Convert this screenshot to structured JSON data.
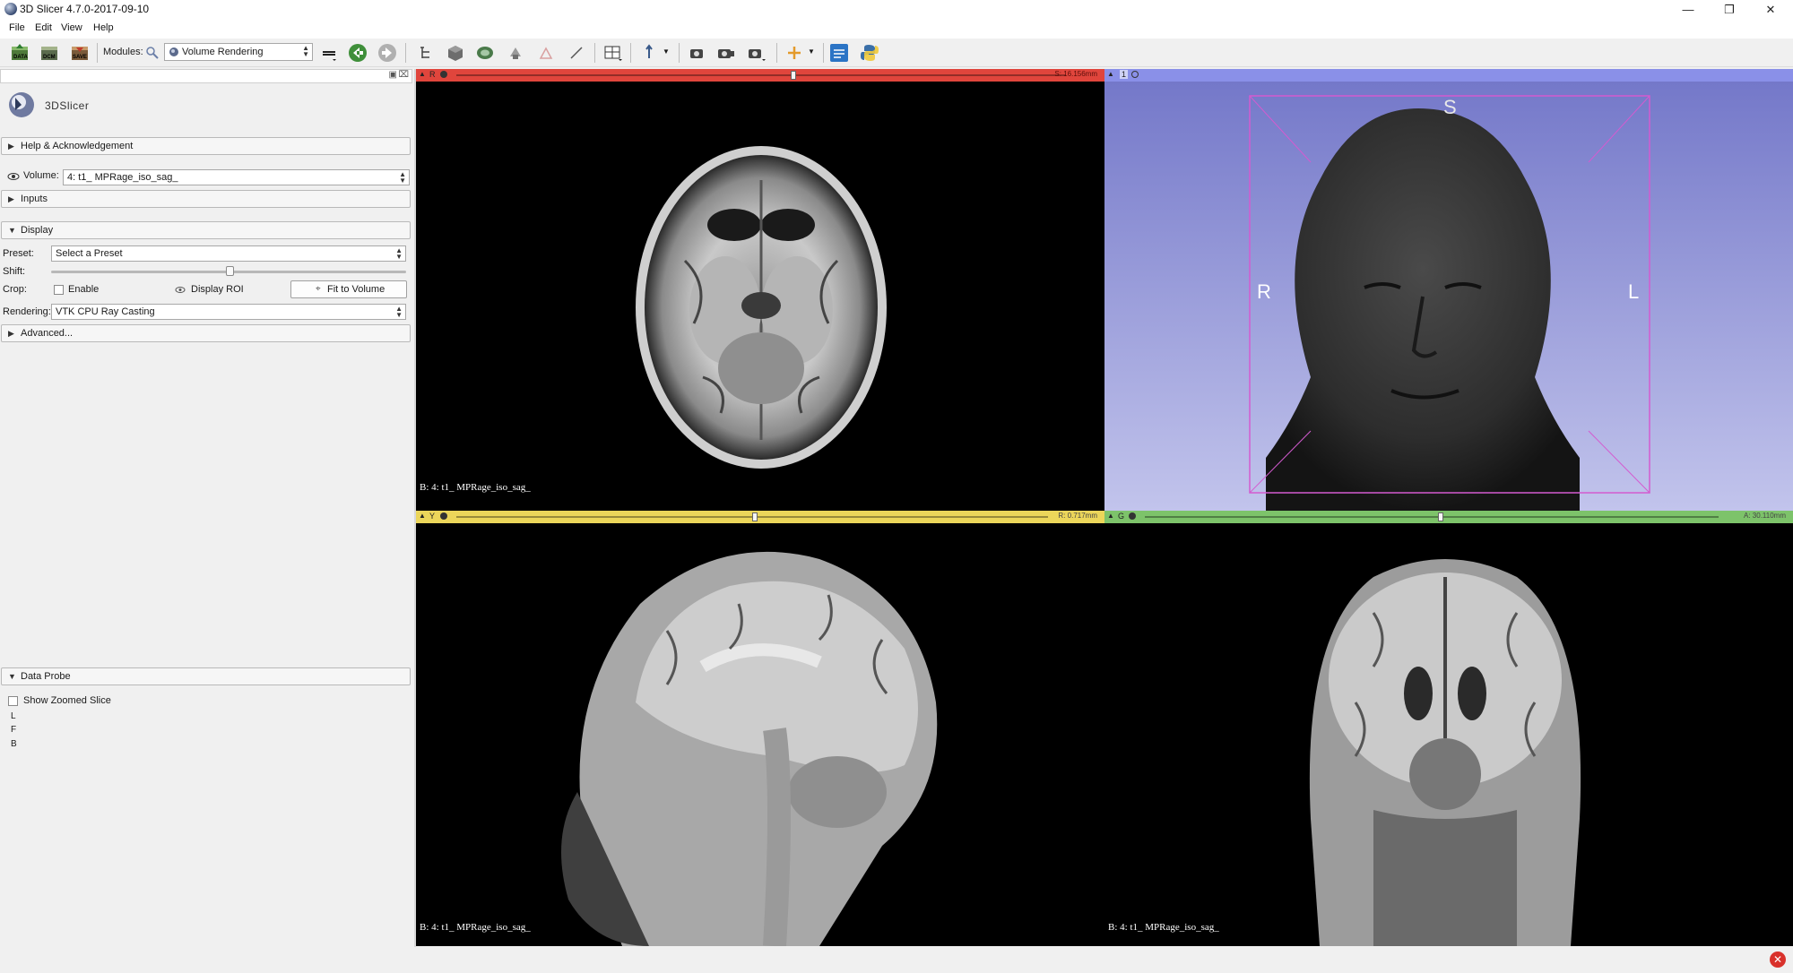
{
  "window": {
    "title": "3D Slicer 4.7.0-2017-09-10"
  },
  "menu": {
    "items": [
      "File",
      "Edit",
      "View",
      "Help"
    ]
  },
  "toolbar": {
    "data_label": "DATA",
    "dcm_label": "DCM",
    "save_label": "SAVE",
    "modules_label": "Modules:",
    "module_selected": "Volume Rendering"
  },
  "leftpanel": {
    "logo_text": "3DSlicer",
    "help_section": "Help & Acknowledgement",
    "volume_label": "Volume:",
    "volume_value": "4: t1_ MPRage_iso_sag_",
    "inputs_section": "Inputs",
    "display_section": "Display",
    "preset_label": "Preset:",
    "preset_value": "Select a Preset",
    "shift_label": "Shift:",
    "crop_label": "Crop:",
    "enable_label": "Enable",
    "display_roi_label": "Display ROI",
    "fit_button": "Fit to Volume",
    "rendering_label": "Rendering:",
    "rendering_value": "VTK CPU Ray Casting",
    "advanced_section": "Advanced...",
    "data_probe_section": "Data Probe",
    "show_zoomed_label": "Show Zoomed Slice",
    "probe_l": "L",
    "probe_f": "F",
    "probe_b": "B"
  },
  "views": {
    "red": {
      "tag": "R",
      "offset": "S: 16.156mm",
      "corner": "B: 4: t1_ MPRage_iso_sag_"
    },
    "threed": {
      "tag": "1",
      "label_s": "S",
      "label_r": "R",
      "label_l": "L"
    },
    "yellow": {
      "tag": "Y",
      "offset": "R: 0.717mm",
      "corner": "B: 4: t1_ MPRage_iso_sag_"
    },
    "green": {
      "tag": "G",
      "offset": "A: 30.110mm",
      "corner": "B: 4: t1_ MPRage_iso_sag_"
    }
  },
  "colors": {
    "red_bar": "#e0453c",
    "yellow_bar": "#ecd65a",
    "green_bar": "#7dc36a",
    "threed_bar": "#8a90e8",
    "threed_bg_top": "#7478c9",
    "threed_bg_bottom": "#c2c4ec",
    "roi_box": "#d45bd0"
  }
}
